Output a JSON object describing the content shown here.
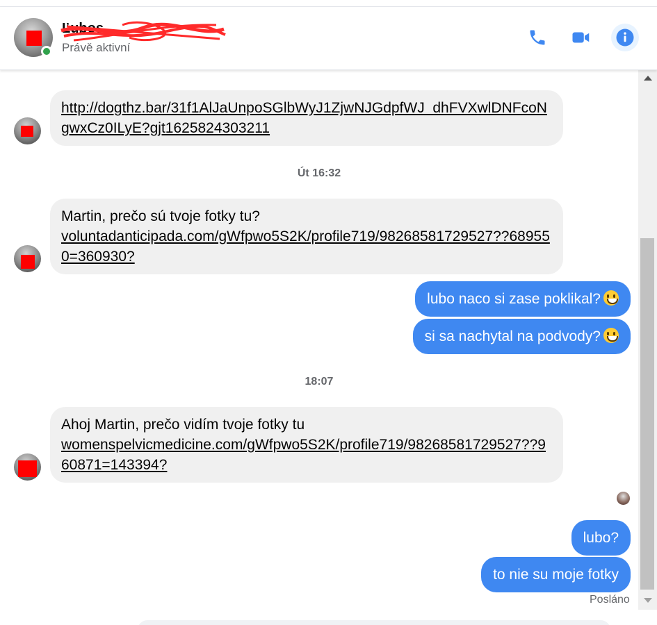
{
  "header": {
    "name": "Ľubos",
    "status": "Právě aktivní",
    "actions": {
      "call_icon": "phone-icon",
      "video_icon": "video-camera-icon",
      "info_icon": "info-icon"
    }
  },
  "colors": {
    "accent": "#3f88f1",
    "incoming_bubble": "#f0f0f0",
    "active_dot": "#31a24c",
    "redaction": "#ff0000"
  },
  "messages": {
    "m1": {
      "link": "http://dogthz.bar/31f1AlJaUnpoSGlbWyJ1ZjwNJGdpfWJ_dhFVXwlDNFcoNgwxCz0ILyE?gjt1625824303211"
    },
    "ts1": "Út 16:32",
    "m2": {
      "text": "Martin, prečo sú tvoje fotky tu?",
      "link": "voluntadanticipada.com/gWfpwo5S2K/profile719/98268581729527??689550=360930?"
    },
    "m3": {
      "text": "lubo naco si zase poklikal?",
      "emoji": "grinning-face"
    },
    "m4": {
      "text": "si sa nachytal na podvody?",
      "emoji": "grinning-face"
    },
    "ts2": "18:07",
    "m5": {
      "text": "Ahoj Martin, prečo vidím tvoje fotky tu",
      "link": "womenspelvicmedicine.com/gWfpwo5S2K/profile719/98268581729527??960871=143394?"
    },
    "m6": {
      "text": "lubo?"
    },
    "m7": {
      "text": "to nie su moje fotky"
    },
    "delivery_status": "Posláno"
  }
}
